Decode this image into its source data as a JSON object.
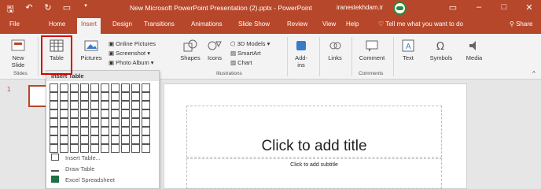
{
  "titlebar": {
    "document_title": "New Microsoft PowerPoint Presentation (2).pptx  -  PowerPoint",
    "user": "iranestekhdam.ir",
    "qat_icons": [
      "save-icon",
      "undo-icon",
      "redo-icon",
      "start-presentation-icon",
      "customize-icon"
    ],
    "window_buttons": [
      "ribbon-display-icon",
      "minimize-icon",
      "maximize-icon",
      "close-icon"
    ]
  },
  "tabs": [
    "File",
    "Home",
    "Insert",
    "Design",
    "Transitions",
    "Animations",
    "Slide Show",
    "Review",
    "View",
    "Help"
  ],
  "active_tab": "Insert",
  "tell_me": "Tell me what you want to do",
  "share": "Share",
  "ribbon": {
    "new_slide": "New\nSlide",
    "table": "Table",
    "pictures": "Pictures",
    "online_pictures": "Online Pictures",
    "screenshot": "Screenshot",
    "photo_album": "Photo Album",
    "shapes": "Shapes",
    "icons": "Icons",
    "models_3d": "3D Models",
    "smartart": "SmartArt",
    "chart": "Chart",
    "addins": "Add-\nins",
    "links": "Links",
    "comment": "Comment",
    "text": "Text",
    "symbols": "Symbols",
    "media": "Media",
    "groups": {
      "slides": "Slides",
      "illustrations": "Illustrations",
      "comments": "Comments"
    }
  },
  "dropdown": {
    "title": "Insert Table",
    "grid_cols": 10,
    "grid_rows": 8,
    "items": [
      "Insert Table...",
      "Draw Table",
      "Excel Spreadsheet"
    ]
  },
  "slide_panel": {
    "slide_number": "1"
  },
  "slide": {
    "title_placeholder": "Click to add title",
    "subtitle_placeholder": "Click to add subtitle"
  },
  "colors": {
    "accent": "#b7472a",
    "highlight": "#d40000"
  }
}
